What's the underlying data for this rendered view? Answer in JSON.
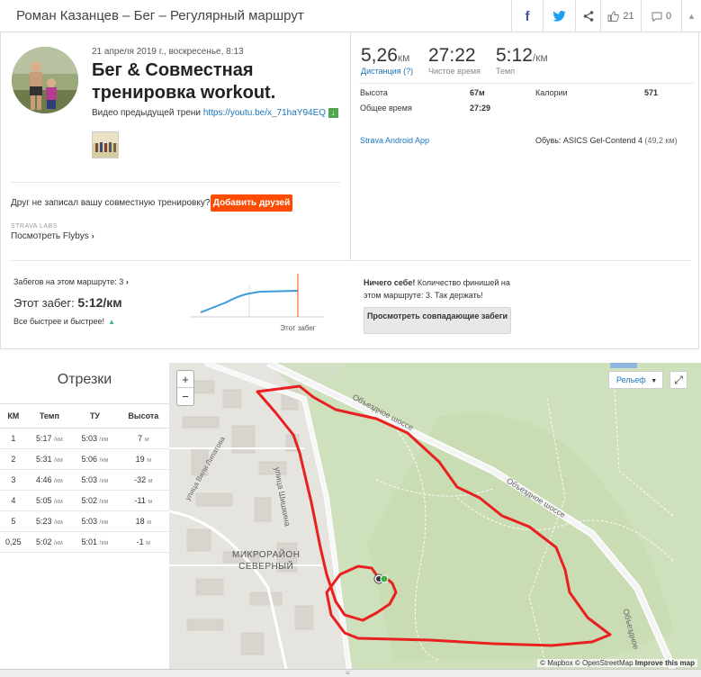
{
  "header": {
    "title": "Роман Казанцев – Бег – Регулярный маршрут",
    "kudos_count": "21",
    "comments_count": "0"
  },
  "activity": {
    "date": "21 апреля 2019 г., воскресенье, 8:13",
    "name": "Бег & Совместная тренировка workout.",
    "description_prefix": "Видео предыдущей трени",
    "description_link": "https://youtu.be/x_71haY94EQ",
    "friend_text": "Друг не записал вашу совместную тренировку?",
    "add_friends_label": "Добавить друзей",
    "labs_label": "STRAVA LABS",
    "flybys_label": "Посмотреть Flybys"
  },
  "stats": {
    "distance_value": "5,26",
    "distance_unit": "км",
    "distance_label": "Дистанция (?)",
    "moving_time_value": "27:22",
    "moving_time_label": "Чистое время",
    "pace_value": "5:12",
    "pace_unit": "/км",
    "pace_label": "Темп",
    "elevation_label": "Высота",
    "elevation_value": "67м",
    "calories_label": "Калории",
    "calories_value": "571",
    "elapsed_label": "Общее время",
    "elapsed_value": "27:29",
    "device": "Strava Android App",
    "gear_label": "Обувь: ASICS Gel-Contend 4",
    "gear_distance": "(49,2 км)"
  },
  "route": {
    "efforts_label": "Забегов на этом маршруте: 3",
    "this_run_label": "Этот забег:",
    "this_run_value": "5:12/км",
    "faster_label": "Все быстрее и быстрее!",
    "chart_label": "Этот забег",
    "wow_bold": "Ничего себе!",
    "wow_text": " Количество финишей на этом маршруте: 3. Так держать!",
    "compare_button": "Просмотреть совпадающие забеги"
  },
  "segments": {
    "title": "Отрезки",
    "columns": [
      "КМ",
      "Темп",
      "ТУ",
      "Высота"
    ],
    "rows": [
      {
        "km": "1",
        "pace": "5:17",
        "gap": "5:03",
        "elev": "7",
        "elev_unit": "м"
      },
      {
        "km": "2",
        "pace": "5:31",
        "gap": "5:06",
        "elev": "19",
        "elev_unit": "м"
      },
      {
        "km": "3",
        "pace": "4:46",
        "gap": "5:03",
        "elev": "-32",
        "elev_unit": "м"
      },
      {
        "km": "4",
        "pace": "5:05",
        "gap": "5:02",
        "elev": "-11",
        "elev_unit": "м"
      },
      {
        "km": "5",
        "pace": "5:23",
        "gap": "5:03",
        "elev": "18",
        "elev_unit": "м"
      },
      {
        "km": "0,25",
        "pace": "5:02",
        "gap": "5:01",
        "elev": "-1",
        "elev_unit": "м"
      }
    ],
    "pace_unit": "/км"
  },
  "map": {
    "relief_label": "Рельеф",
    "zoom_in": "+",
    "zoom_out": "−",
    "district_line1": "МИКРОРАЙОН",
    "district_line2": "СЕВЕРНЫЙ",
    "road1": "Объездное шоссе",
    "road2": "Объездное шоссе",
    "road3": "улица Шишкина",
    "road4": "улица Вили Липатова",
    "road5": "Объездное",
    "attribution_mapbox": "© Mapbox",
    "attribution_osm": "© OpenStreetMap",
    "improve": "Improve this map",
    "route_color": "#e8201f"
  }
}
